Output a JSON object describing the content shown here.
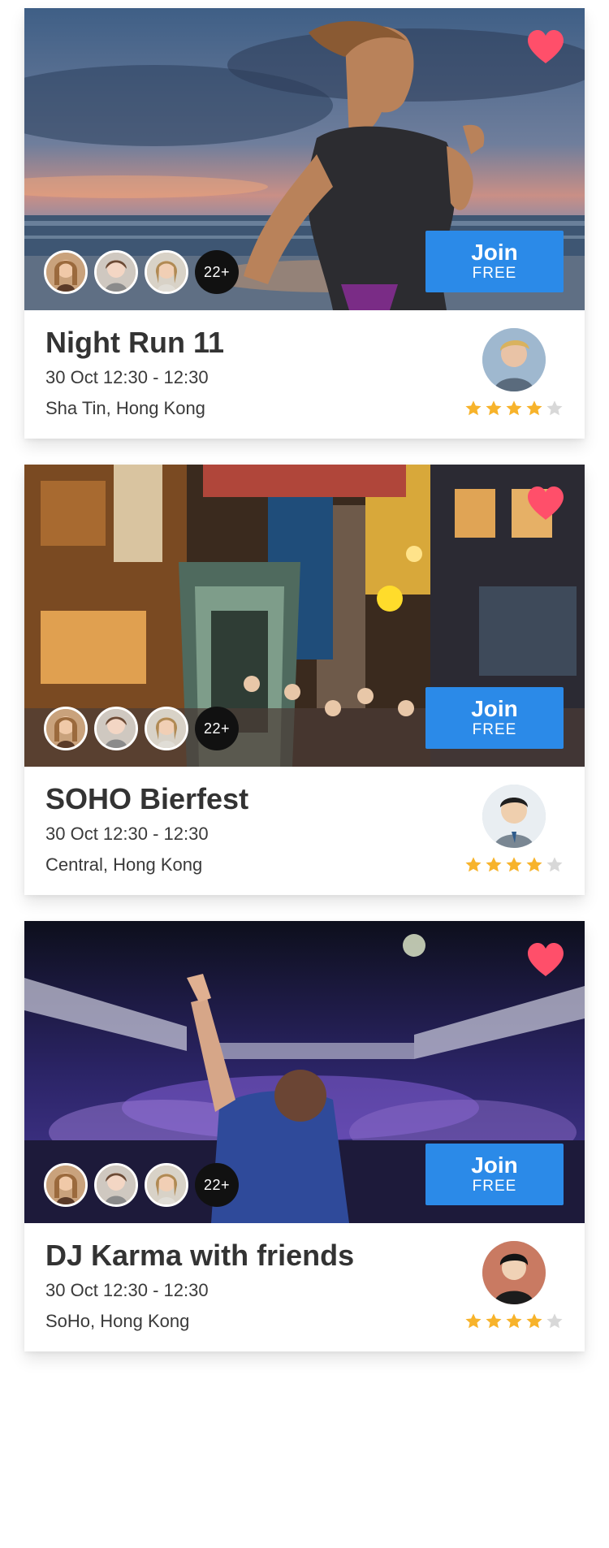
{
  "colors": {
    "accent": "#2b8ae8",
    "heart": "#ff4f6a",
    "star_on": "#f7b32b",
    "star_off": "#d8d8d8",
    "text": "#333333"
  },
  "events": [
    {
      "title": "Night Run 11",
      "datetime": "30 Oct 12:30 - 12:30",
      "location": "Sha Tin, Hong Kong",
      "attendee_more": "22+",
      "join_label": "Join",
      "join_sub": "FREE",
      "rating": 4,
      "rating_max": 5,
      "favorited": true,
      "image_icon": "runner-on-beach-photo",
      "host_icon": "host-avatar-blond-man"
    },
    {
      "title": "SOHO Bierfest",
      "datetime": "30 Oct 12:30 - 12:30",
      "location": "Central, Hong Kong",
      "attendee_more": "22+",
      "join_label": "Join",
      "join_sub": "FREE",
      "rating": 4,
      "rating_max": 5,
      "favorited": true,
      "image_icon": "city-street-escalator-photo",
      "host_icon": "host-avatar-man-suit"
    },
    {
      "title": "DJ Karma with friends",
      "datetime": "30 Oct 12:30 - 12:30",
      "location": "SoHo, Hong Kong",
      "attendee_more": "22+",
      "join_label": "Join",
      "join_sub": "FREE",
      "rating": 4,
      "rating_max": 5,
      "favorited": true,
      "image_icon": "dj-concert-crowd-photo",
      "host_icon": "host-avatar-man-dark-hair"
    }
  ]
}
